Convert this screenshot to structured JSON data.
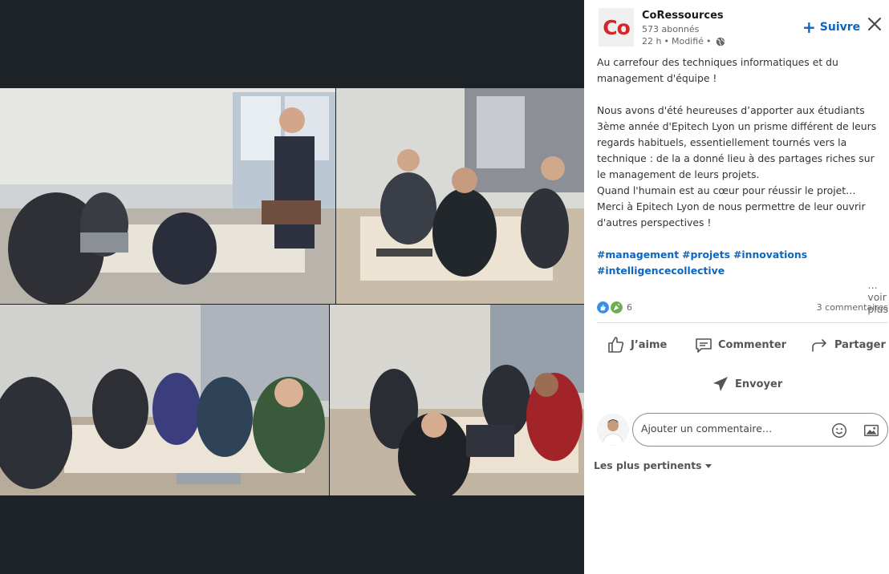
{
  "post": {
    "author": "CoRessources",
    "logo_text": "Co",
    "followers": "573 abonnés",
    "time": "22 h",
    "edited": "Modifié",
    "follow_label": "Suivre",
    "text": "Au carrefour des techniques informatiques et du management d'équipe !\n\nNous avons d'été heureuses d’apporter aux étudiants 3ème année d'Epitech Lyon un prisme différent de leurs regards habituels, essentiellement tournés vers la technique : de la a donné lieu à des partages riches sur le management de leurs projets.\nQuand l'humain est au cœur pour réussir le projet…\nMerci à Epitech Lyon de nous permettre de leur ouvrir d'autres perspectives !",
    "hashtags": [
      "#management",
      "#projets",
      "#innovations",
      "#intelligencecollective"
    ],
    "see_more": "…voir plus",
    "reactions_count": "6",
    "comments_count": "3 commentaires"
  },
  "actions": {
    "like": "J’aime",
    "comment": "Commenter",
    "share": "Partager",
    "send": "Envoyer"
  },
  "comment": {
    "placeholder": "Ajouter un commentaire…"
  },
  "sort": {
    "label": "Les plus pertinents"
  },
  "colors": {
    "accent": "#0a66c2",
    "logo_red": "#d6262a",
    "viewer_bg": "#1d2226"
  },
  "icons": [
    "close-icon",
    "globe-icon",
    "like-icon",
    "comment-icon",
    "share-icon",
    "send-icon",
    "emoji-icon",
    "image-icon",
    "caret-down-icon"
  ]
}
